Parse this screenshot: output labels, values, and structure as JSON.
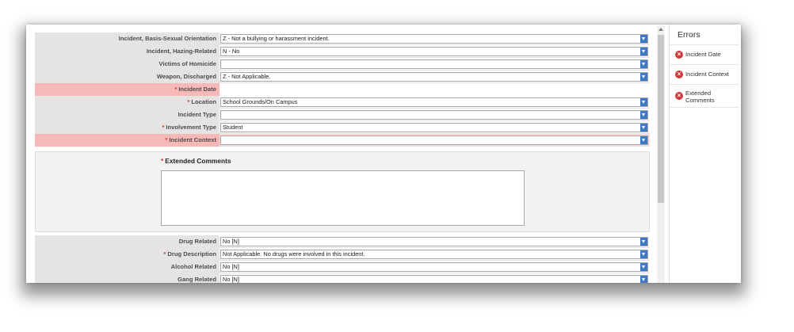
{
  "form": {
    "rows_top": [
      {
        "label": "Incident, Basis-Sexual Orientation",
        "required": false,
        "value": "Z - Not a bullying or harassment incident.",
        "error": false
      },
      {
        "label": "Incident, Hazing-Related",
        "required": false,
        "value": "N - No",
        "error": false
      },
      {
        "label": "Victims of Homicide",
        "required": false,
        "value": "",
        "error": false
      },
      {
        "label": "Weapon, Discharged",
        "required": false,
        "value": "Z - Not Applicable.",
        "error": false
      },
      {
        "label": "Incident Date",
        "required": true,
        "value": "",
        "error": true,
        "no_select": true
      },
      {
        "label": "Location",
        "required": true,
        "value": "School Grounds/On Campus",
        "error": false
      },
      {
        "label": "Incident Type",
        "required": false,
        "value": "",
        "error": false
      },
      {
        "label": "Involvement Type",
        "required": true,
        "value": "Student",
        "error": false
      },
      {
        "label": "Incident Context",
        "required": true,
        "value": "",
        "error": true
      }
    ],
    "extended_comments": {
      "label": "Extended Comments",
      "required": true,
      "value": ""
    },
    "rows_bottom": [
      {
        "label": "Drug Related",
        "required": false,
        "value": "No [N]",
        "error": false
      },
      {
        "label": "Drug Description",
        "required": true,
        "value": "Not Applicable. No drugs were involved in this incident.",
        "error": false
      },
      {
        "label": "Alcohol Related",
        "required": false,
        "value": "No [N]",
        "error": false
      },
      {
        "label": "Gang Related",
        "required": false,
        "value": "No [N]",
        "error": false
      }
    ],
    "required_marker": "*"
  },
  "errors": {
    "title": "Errors",
    "items": [
      "Incident Date",
      "Incident Context",
      "Extended Comments"
    ]
  },
  "colors": {
    "error_label_bg": "#f7b8b8",
    "dropdown_button": "#3d79c6",
    "error_icon": "#cf3b3b"
  }
}
